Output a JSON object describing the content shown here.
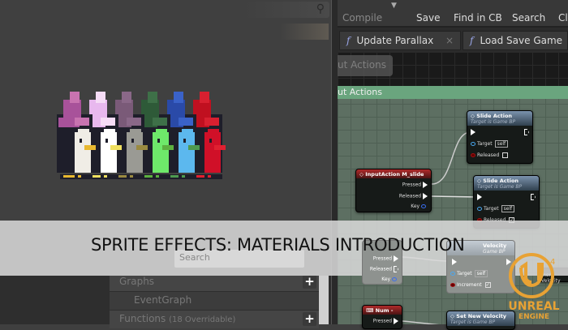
{
  "toolbar": {
    "compile": "Compile",
    "save": "Save",
    "find_in_cb": "Find in CB",
    "search": "Search",
    "class_partial": "Cl"
  },
  "tabs": [
    {
      "icon": "f",
      "label": "Update Parallax",
      "close": "×"
    },
    {
      "icon": "f",
      "label": "Load Save Game"
    }
  ],
  "graph": {
    "breadcrumb": "ut Actions",
    "section_title": "ut Actions",
    "nodes": {
      "slide1": {
        "title": "Slide Action",
        "subtitle": "Target is Game BP",
        "target": "Target",
        "self": "self",
        "released": "Released"
      },
      "input": {
        "title": "InputAction M_slide",
        "pressed": "Pressed",
        "released": "Released",
        "key": "Key"
      },
      "slide2": {
        "title": "Slide Action",
        "subtitle": "Target is Game BP",
        "target": "Target",
        "self": "self",
        "released": "Released"
      },
      "input2": {
        "pressed": "Pressed",
        "released": "Released",
        "key": "Key"
      },
      "velocity": {
        "title": "Velocity",
        "subtitle": "Game BP",
        "target": "Target",
        "self": "self",
        "increment": "Increment"
      },
      "num": {
        "title": "Num -",
        "pressed": "Pressed"
      },
      "setvel": {
        "title": "Set New Velocity",
        "subtitle": "Target is Game BP"
      },
      "partial": {
        "title": "ment Velocity"
      }
    }
  },
  "left_panel": {
    "graphs": "Graphs",
    "event_graph": "EventGraph",
    "functions": "Functions",
    "functions_count": "(18 Overridable)",
    "add": "+",
    "search_placeholder": "Search"
  },
  "banner": {
    "title": "SPRITE EFFECTS: MATERIALS INTRODUCTION"
  },
  "logo": {
    "line1": "UNREAL",
    "line2": "ENGINE",
    "mark": "4",
    "color": "#e8a234"
  },
  "sprites": [
    {
      "name": "purple",
      "hat": "#a8529a",
      "hat2": "#c873b0",
      "body": "#f0ede6",
      "beak": "#e8b830"
    },
    {
      "name": "pink",
      "hat": "#e8b8ee",
      "hat2": "#f6dcf6",
      "body": "#ffffff",
      "beak": "#f0e060"
    },
    {
      "name": "faded",
      "hat": "#7a5a78",
      "hat2": "#8a6888",
      "body": "#9a9a94",
      "beak": "#9a8a40"
    },
    {
      "name": "green",
      "hat": "#2e5a38",
      "hat2": "#3e7048",
      "body": "#6ee86a",
      "beak": "#5cb040"
    },
    {
      "name": "blue",
      "hat": "#2a4aa8",
      "hat2": "#3a62c8",
      "body": "#5cb8ee",
      "beak": "#4e9a50"
    },
    {
      "name": "red",
      "hat": "#c01020",
      "hat2": "#d82030",
      "body": "#d01028",
      "beak": "#e02030"
    }
  ]
}
